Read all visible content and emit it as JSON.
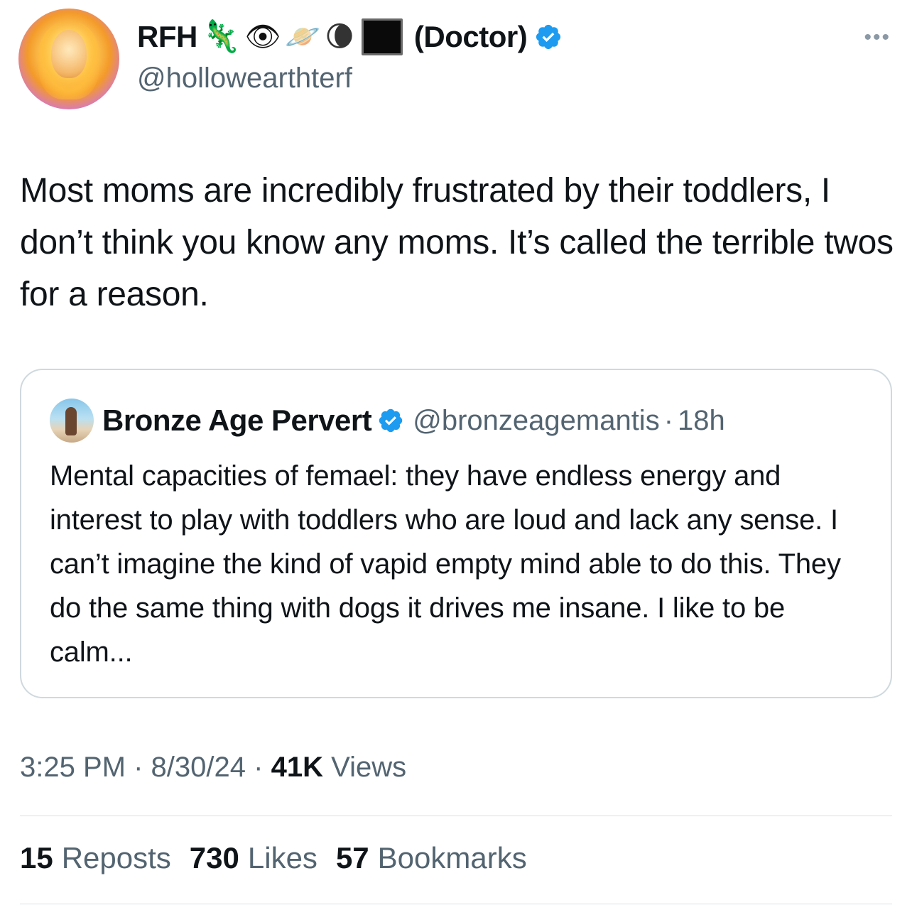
{
  "author": {
    "display_name": "RFH",
    "emojis": [
      "lizard-emoji",
      "eye-in-speech-bubble-emoji",
      "ringed-planet-emoji",
      "moon-emoji"
    ],
    "title_suffix": "(Doctor)",
    "handle": "@hollowearthterf",
    "verified": true
  },
  "tweet": {
    "text": "Most moms are incredibly frustrated by their toddlers, I don’t think you know any moms. It’s called the terrible twos for a reason."
  },
  "quoted_tweet": {
    "display_name": "Bronze Age Pervert",
    "handle": "@bronzeagemantis",
    "separator": "·",
    "time_ago": "18h",
    "verified": true,
    "text": "Mental capacities of femael: they have endless energy and interest to play with toddlers who are loud and lack any sense. I can’t imagine the kind of vapid empty mind able to do this. They do the same thing with dogs it drives me insane. I like to be calm..."
  },
  "meta": {
    "time": "3:25 PM",
    "sep1": "·",
    "date": "8/30/24",
    "sep2": "·",
    "views_count": "41K",
    "views_label": "Views"
  },
  "stats": {
    "reposts_count": "15",
    "reposts_label": "Reposts",
    "likes_count": "730",
    "likes_label": "Likes",
    "bookmarks_count": "57",
    "bookmarks_label": "Bookmarks"
  },
  "colors": {
    "verified_blue": "#1d9bf0",
    "secondary_text": "#536471",
    "primary_text": "#0f1419",
    "border": "#cfd9de"
  }
}
